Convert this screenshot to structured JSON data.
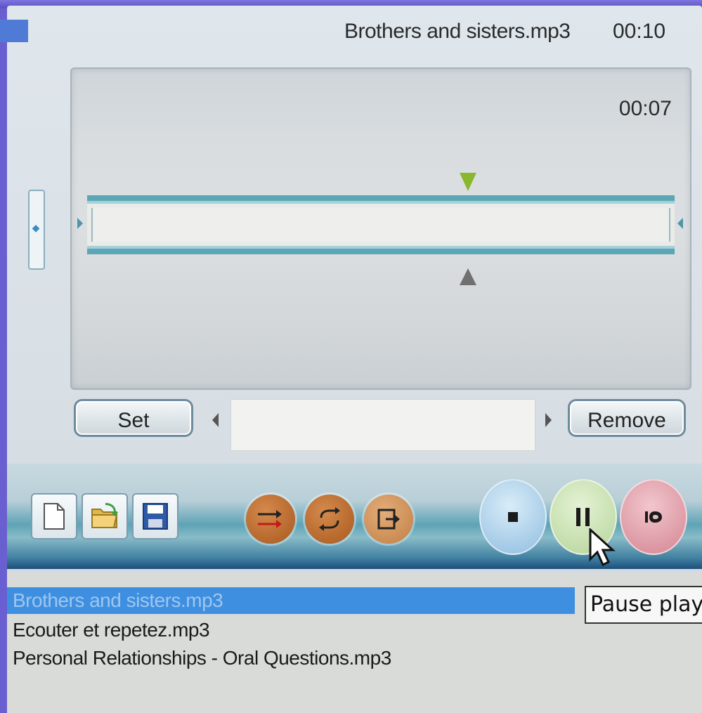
{
  "header": {
    "file_name": "Brothers and sisters.mp3",
    "total_time": "00:10"
  },
  "wave": {
    "current_time": "00:07"
  },
  "bookmarks": {
    "set_label": "Set",
    "remove_label": "Remove",
    "field_value": ""
  },
  "toolbar": {
    "file_buttons": [
      "new-file-icon",
      "open-folder-icon",
      "save-disk-icon"
    ],
    "mode_buttons": [
      "sequence-icon",
      "repeat-icon",
      "exit-icon"
    ],
    "transport_buttons": [
      "stop-icon",
      "pause-icon",
      "next-icon"
    ]
  },
  "playlist": {
    "items": [
      "Brothers and sisters.mp3",
      "Ecouter et repetez.mp3",
      "Personal Relationships - Oral Questions.mp3"
    ],
    "selected_index": 0
  },
  "tooltip": {
    "text": "Pause play"
  },
  "colors": {
    "accent": "#5aa6b4",
    "selection": "#3e8fe0",
    "background": "#6a5fd0"
  }
}
